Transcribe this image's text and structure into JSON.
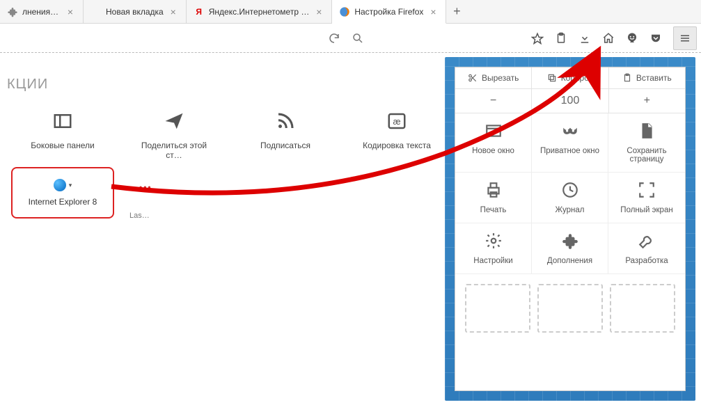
{
  "tabs": [
    {
      "label": "лнения…",
      "favicon": "generic"
    },
    {
      "label": "Новая вкладка",
      "favicon": "blank"
    },
    {
      "label": "Яндекс.Интернетометр …",
      "favicon": "yandex"
    },
    {
      "label": "Настройка Firefox",
      "favicon": "firefox",
      "active": true
    }
  ],
  "newtab_glyph": "+",
  "toolbar": {
    "reload": "⟳",
    "search": "🔍"
  },
  "section_title": "КЦИИ",
  "shelf": [
    {
      "key": "sidebar",
      "label": "Боковые панели"
    },
    {
      "key": "share",
      "label": "Поделиться этой ст…"
    },
    {
      "key": "subscribe",
      "label": "Подписаться"
    },
    {
      "key": "encoding",
      "label": "Кодировка текста"
    }
  ],
  "ie_item": {
    "label": "Internet Explorer 8"
  },
  "lastpass": {
    "dots": "•••",
    "label": "Las…"
  },
  "panel": {
    "edit": {
      "cut": "Вырезать",
      "copy": "Копиров",
      "paste": "Вставить"
    },
    "zoom": {
      "minus": "−",
      "value": "100",
      "plus": "+"
    },
    "grid": [
      {
        "key": "new-window",
        "label": "Новое окно"
      },
      {
        "key": "private",
        "label": "Приватное окно"
      },
      {
        "key": "save-page",
        "label": "Сохранить страницу"
      },
      {
        "key": "print",
        "label": "Печать"
      },
      {
        "key": "history",
        "label": "Журнал"
      },
      {
        "key": "fullscreen",
        "label": "Полный экран"
      },
      {
        "key": "settings",
        "label": "Настройки"
      },
      {
        "key": "addons",
        "label": "Дополнения"
      },
      {
        "key": "developer",
        "label": "Разработка"
      }
    ]
  }
}
